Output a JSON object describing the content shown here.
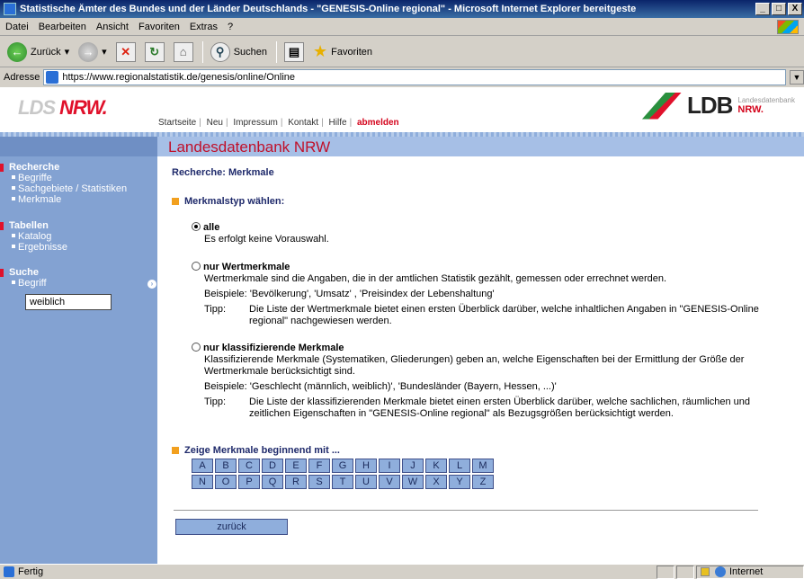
{
  "window": {
    "title": "Statistische Ämter des Bundes und der Länder Deutschlands - \"GENESIS-Online regional\" - Microsoft Internet Explorer bereitgeste",
    "buttons": {
      "minimize": "_",
      "maximize": "□",
      "close": "X"
    }
  },
  "menu": [
    "Datei",
    "Bearbeiten",
    "Ansicht",
    "Favoriten",
    "Extras",
    "?"
  ],
  "toolbar": {
    "back": "Zurück",
    "search": "Suchen",
    "favorites": "Favoriten"
  },
  "address": {
    "label": "Adresse",
    "url": "https://www.regionalstatistik.de/genesis/online/Online"
  },
  "header": {
    "logo_left_a": "LDS",
    "logo_left_b": "NRW.",
    "logo_right": "LDB",
    "logo_right_sub": "Landesdatenbank",
    "logo_right_nrw": "NRW.",
    "nav": [
      "Startseite",
      "Neu",
      "Impressum",
      "Kontakt",
      "Hilfe"
    ],
    "logout": "abmelden",
    "brand": "Landesdatenbank NRW"
  },
  "sidebar": {
    "recherche": {
      "title": "Recherche",
      "items": [
        "Begriffe",
        "Sachgebiete / Statistiken",
        "Merkmale"
      ]
    },
    "tabellen": {
      "title": "Tabellen",
      "items": [
        "Katalog",
        "Ergebnisse"
      ]
    },
    "suche": {
      "title": "Suche",
      "items": [
        "Begriff"
      ],
      "input_value": "weiblich"
    }
  },
  "content": {
    "heading": "Recherche: Merkmale",
    "section_type": "Merkmalstyp wählen:",
    "options": [
      {
        "label": "alle",
        "checked": true,
        "desc": "Es erfolgt keine Vorauswahl."
      },
      {
        "label": "nur Wertmerkmale",
        "checked": false,
        "desc": "Wertmerkmale sind die Angaben, die in der amtlichen Statistik gezählt, gemessen oder errechnet werden.",
        "example": "Beispiele: 'Bevölkerung', 'Umsatz' , 'Preisindex der Lebenshaltung'",
        "tip_label": "Tipp:",
        "tip": "Die Liste der Wertmerkmale bietet einen ersten Überblick darüber, welche inhaltlichen Angaben in \"GENESIS-Online regional\" nachgewiesen werden."
      },
      {
        "label": "nur klassifizierende Merkmale",
        "checked": false,
        "desc": "Klassifizierende Merkmale (Systematiken, Gliederungen) geben an, welche Eigenschaften bei der Ermittlung der Größe der Wertmerkmale berücksichtigt sind.",
        "example": "Beispiele: 'Geschlecht (männlich, weiblich)', 'Bundesländer (Bayern, Hessen, ...)'",
        "tip_label": "Tipp:",
        "tip": "Die Liste der klassifizierenden Merkmale bietet einen ersten Überblick darüber, welche sachlichen, räumlichen und zeitlichen Eigenschaften in \"GENESIS-Online regional\" als Bezugsgrößen berücksichtigt werden."
      }
    ],
    "section_letters": "Zeige Merkmale beginnend mit ...",
    "letters_row1": [
      "A",
      "B",
      "C",
      "D",
      "E",
      "F",
      "G",
      "H",
      "I",
      "J",
      "K",
      "L",
      "M"
    ],
    "letters_row2": [
      "N",
      "O",
      "P",
      "Q",
      "R",
      "S",
      "T",
      "U",
      "V",
      "W",
      "X",
      "Y",
      "Z"
    ],
    "back_button": "zurück"
  },
  "status": {
    "text": "Fertig",
    "zone": "Internet"
  }
}
